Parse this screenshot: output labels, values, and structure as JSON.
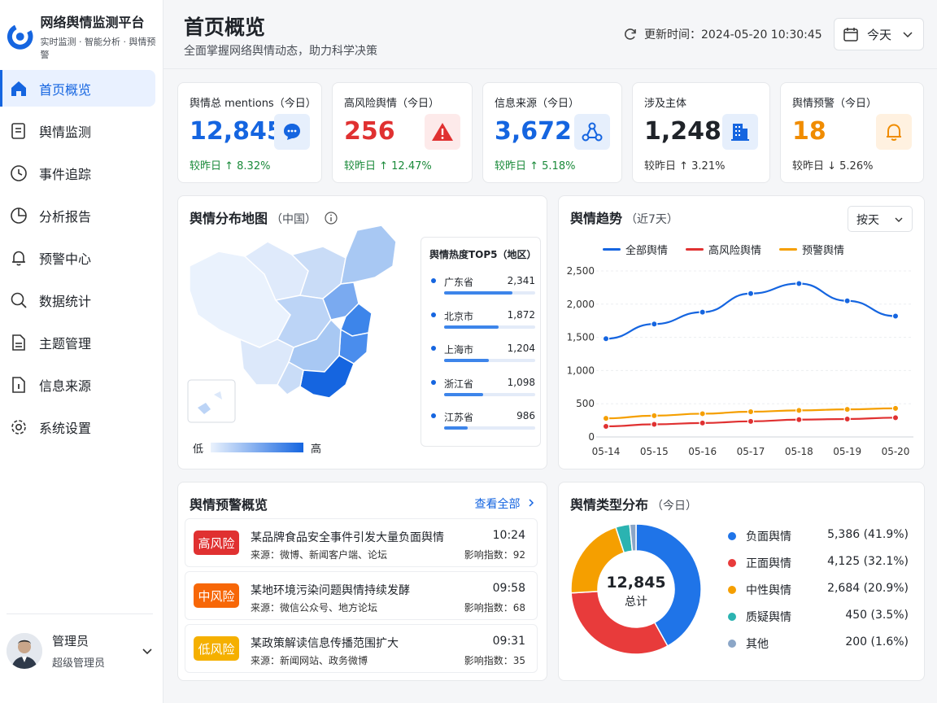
{
  "brand": {
    "title": "网络舆情监测平台",
    "subtitle": "实时监测 · 智能分析 · 舆情预警"
  },
  "nav": [
    {
      "label": "首页概览",
      "icon": "home-icon",
      "active": true
    },
    {
      "label": "舆情监测",
      "icon": "document-icon"
    },
    {
      "label": "事件追踪",
      "icon": "clock-icon"
    },
    {
      "label": "分析报告",
      "icon": "pie-chart-icon"
    },
    {
      "label": "预警中心",
      "icon": "bell-icon"
    },
    {
      "label": "数据统计",
      "icon": "search-icon"
    },
    {
      "label": "主题管理",
      "icon": "file-icon"
    },
    {
      "label": "信息来源",
      "icon": "file-info-icon"
    },
    {
      "label": "系统设置",
      "icon": "gear-icon"
    }
  ],
  "user": {
    "name": "管理员",
    "role": "超级管理员"
  },
  "header": {
    "title": "首页概览",
    "subtitle": "全面掌握网络舆情动态，助力科学决策",
    "update_label": "更新时间：2024-05-20 10:30:45",
    "date_select": "今天"
  },
  "stats": [
    {
      "label": "舆情总 mentions（今日）",
      "value": "12,845",
      "delta": "较昨日 ↑ 8.32%",
      "value_color": "#1565e0",
      "delta_color": "#1a8a3a",
      "icon": "chat-bubble-icon",
      "icon_bg": "#e6effc",
      "icon_color": "#1565e0"
    },
    {
      "label": "高风险舆情（今日）",
      "value": "256",
      "delta": "较昨日 ↑ 12.47%",
      "value_color": "#e03131",
      "delta_color": "#1a8a3a",
      "icon": "warning-icon",
      "icon_bg": "#fdeaea",
      "icon_color": "#e03131"
    },
    {
      "label": "信息来源（今日）",
      "value": "3,672",
      "delta": "较昨日 ↑ 5.18%",
      "value_color": "#1565e0",
      "delta_color": "#1a8a3a",
      "icon": "network-icon",
      "icon_bg": "#e6effc",
      "icon_color": "#1565e0"
    },
    {
      "label": "涉及主体",
      "value": "1,248",
      "delta": "较昨日 ↑ 3.21%",
      "value_color": "#1f2329",
      "delta_color": "#333333",
      "icon": "building-icon",
      "icon_bg": "#e6effc",
      "icon_color": "#1565e0"
    },
    {
      "label": "舆情预警（今日）",
      "value": "18",
      "delta": "较昨日 ↓ 5.26%",
      "value_color": "#f08c00",
      "delta_color": "#333333",
      "icon": "bell-icon",
      "icon_bg": "#fff1e0",
      "icon_color": "#f08c00"
    }
  ],
  "map": {
    "title": "舆情分布地图",
    "scope": "（中国）",
    "top5_title": "舆情热度TOP5（地区）",
    "top5": [
      {
        "name": "广东省",
        "value": "2,341",
        "ratio": 0.75
      },
      {
        "name": "北京市",
        "value": "1,872",
        "ratio": 0.6
      },
      {
        "name": "上海市",
        "value": "1,204",
        "ratio": 0.49
      },
      {
        "name": "浙江省",
        "value": "1,098",
        "ratio": 0.43
      },
      {
        "name": "江苏省",
        "value": "986",
        "ratio": 0.26
      }
    ],
    "legend_low": "低",
    "legend_high": "高"
  },
  "trend": {
    "title": "舆情趋势",
    "scope": "（近7天）",
    "select": "按天"
  },
  "chart_data": {
    "type": "line",
    "categories": [
      "05-14",
      "05-15",
      "05-16",
      "05-17",
      "05-18",
      "05-19",
      "05-20"
    ],
    "ylim": [
      0,
      2500
    ],
    "yticks": [
      "0",
      "500",
      "1,000",
      "1,500",
      "2,000",
      "2,500"
    ],
    "series": [
      {
        "name": "全部舆情",
        "color": "#1565e0",
        "values": [
          1480,
          1700,
          1880,
          2160,
          2310,
          2050,
          1820
        ]
      },
      {
        "name": "高风险舆情",
        "color": "#e03131",
        "values": [
          160,
          190,
          210,
          235,
          260,
          270,
          290
        ]
      },
      {
        "name": "预警舆情",
        "color": "#f59f00",
        "values": [
          280,
          320,
          350,
          380,
          400,
          415,
          430
        ]
      }
    ]
  },
  "alerts": {
    "title": "舆情预警概览",
    "view_all": "查看全部",
    "items": [
      {
        "level": "高风险",
        "color": "#e03131",
        "title": "某品牌食品安全事件引发大量负面舆情",
        "source": "来源：微博、新闻客户端、论坛",
        "time": "10:24",
        "index": "影响指数：92"
      },
      {
        "level": "中风险",
        "color": "#f76707",
        "title": "某地环境污染问题舆情持续发酵",
        "source": "来源：微信公众号、地方论坛",
        "time": "09:58",
        "index": "影响指数：68"
      },
      {
        "level": "低风险",
        "color": "#f5b000",
        "title": "某政策解读信息传播范围扩大",
        "source": "来源：新闻网站、政务微博",
        "time": "09:31",
        "index": "影响指数：35"
      }
    ]
  },
  "types": {
    "title": "舆情类型分布",
    "scope": "（今日）",
    "total": "12,845",
    "total_label": "总计",
    "items": [
      {
        "name": "负面舆情",
        "value": "5,386 (41.9%)",
        "count": 5386,
        "color": "#1f74e8"
      },
      {
        "name": "正面舆情",
        "value": "4,125 (32.1%)",
        "count": 4125,
        "color": "#e83b3b"
      },
      {
        "name": "中性舆情",
        "value": "2,684 (20.9%)",
        "count": 2684,
        "color": "#f59f00"
      },
      {
        "name": "质疑舆情",
        "value": "450  (3.5%)",
        "count": 450,
        "color": "#2bb3b1"
      },
      {
        "name": "其他",
        "value": "200  (1.6%)",
        "count": 200,
        "color": "#8ba6c7"
      }
    ]
  }
}
